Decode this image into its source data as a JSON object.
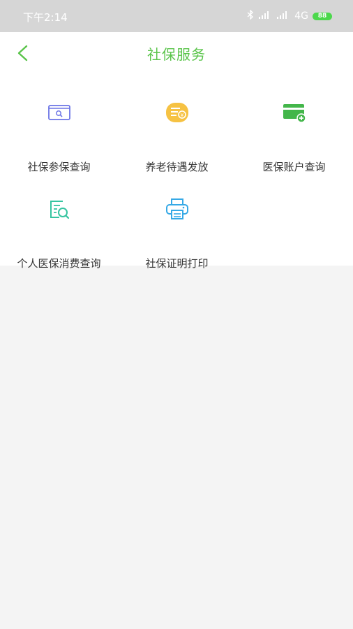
{
  "status_bar": {
    "time": "下午2:14",
    "network": "4G",
    "battery": "88"
  },
  "header": {
    "title": "社保服务",
    "back_icon": "chevron-left-icon"
  },
  "services": [
    {
      "label": "社保参保查询",
      "icon": "id-card-search-icon",
      "color": "#6b74e6"
    },
    {
      "label": "养老待遇发放",
      "icon": "list-coin-icon",
      "color": "#f6c243"
    },
    {
      "label": "医保账户查询",
      "icon": "card-plus-icon",
      "color": "#43b64a"
    },
    {
      "label": "个人医保消费查询",
      "icon": "document-search-icon",
      "color": "#35c4a0"
    },
    {
      "label": "社保证明打印",
      "icon": "printer-icon",
      "color": "#36a9e6"
    }
  ],
  "colors": {
    "accent": "#5ac44a",
    "status_bar": "#d6d6d6",
    "page_background": "#f4f4f4"
  }
}
